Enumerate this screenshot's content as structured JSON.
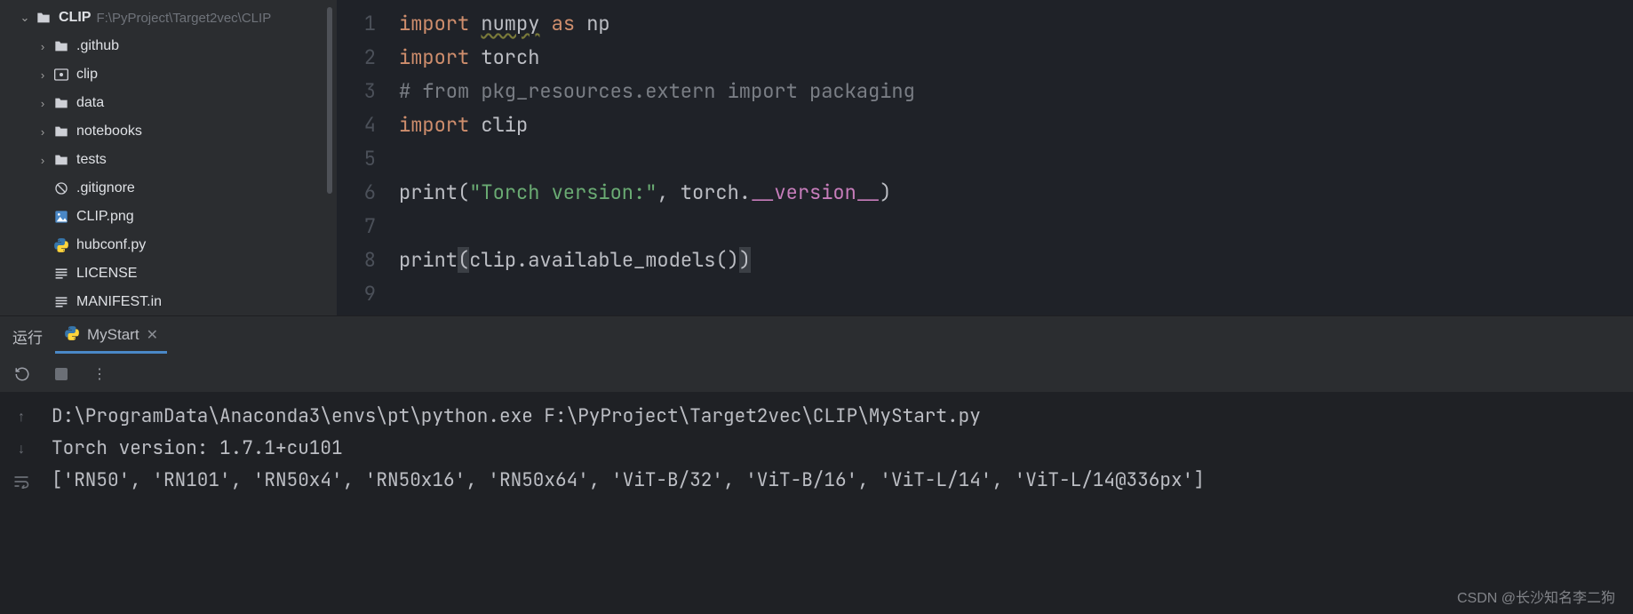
{
  "sidebar": {
    "root": {
      "name": "CLIP",
      "path": "F:\\PyProject\\Target2vec\\CLIP"
    },
    "items": [
      {
        "name": ".github",
        "type": "folder",
        "expandable": true
      },
      {
        "name": "clip",
        "type": "module",
        "expandable": true
      },
      {
        "name": "data",
        "type": "folder",
        "expandable": true
      },
      {
        "name": "notebooks",
        "type": "folder",
        "expandable": true
      },
      {
        "name": "tests",
        "type": "folder",
        "expandable": true
      },
      {
        "name": ".gitignore",
        "type": "ignore",
        "expandable": false
      },
      {
        "name": "CLIP.png",
        "type": "image",
        "expandable": false
      },
      {
        "name": "hubconf.py",
        "type": "python",
        "expandable": false
      },
      {
        "name": "LICENSE",
        "type": "text",
        "expandable": false
      },
      {
        "name": "MANIFEST.in",
        "type": "text",
        "expandable": false
      }
    ]
  },
  "editor": {
    "lines": [
      {
        "n": "1",
        "tokens": [
          [
            "kw",
            "import "
          ],
          [
            "ident underline",
            "numpy"
          ],
          [
            "ident",
            " "
          ],
          [
            "kw",
            "as "
          ],
          [
            "ident",
            "np"
          ]
        ]
      },
      {
        "n": "2",
        "tokens": [
          [
            "kw",
            "import "
          ],
          [
            "ident",
            "torch"
          ]
        ]
      },
      {
        "n": "3",
        "tokens": [
          [
            "comment",
            "# from pkg_resources.extern import packaging"
          ]
        ]
      },
      {
        "n": "4",
        "tokens": [
          [
            "kw",
            "import "
          ],
          [
            "ident",
            "clip"
          ]
        ]
      },
      {
        "n": "5",
        "tokens": []
      },
      {
        "n": "6",
        "tokens": [
          [
            "ident",
            "print("
          ],
          [
            "str",
            "\"Torch version:\""
          ],
          [
            "ident",
            ", torch."
          ],
          [
            "magic",
            "__version__"
          ],
          [
            "ident",
            ")"
          ]
        ]
      },
      {
        "n": "7",
        "tokens": []
      },
      {
        "n": "8",
        "tokens": [
          [
            "ident",
            "print"
          ],
          [
            "ident paren-hl",
            "("
          ],
          [
            "ident",
            "clip.available_models()"
          ],
          [
            "ident paren-hl",
            ")"
          ]
        ]
      },
      {
        "n": "9",
        "tokens": []
      }
    ]
  },
  "tabbar": {
    "run_label": "运行",
    "tab_name": "MyStart"
  },
  "console": {
    "lines": [
      "D:\\ProgramData\\Anaconda3\\envs\\pt\\python.exe F:\\PyProject\\Target2vec\\CLIP\\MyStart.py ",
      "Torch version: 1.7.1+cu101",
      "['RN50', 'RN101', 'RN50x4', 'RN50x16', 'RN50x64', 'ViT-B/32', 'ViT-B/16', 'ViT-L/14', 'ViT-L/14@336px']"
    ]
  },
  "watermark": "CSDN @长沙知名李二狗"
}
